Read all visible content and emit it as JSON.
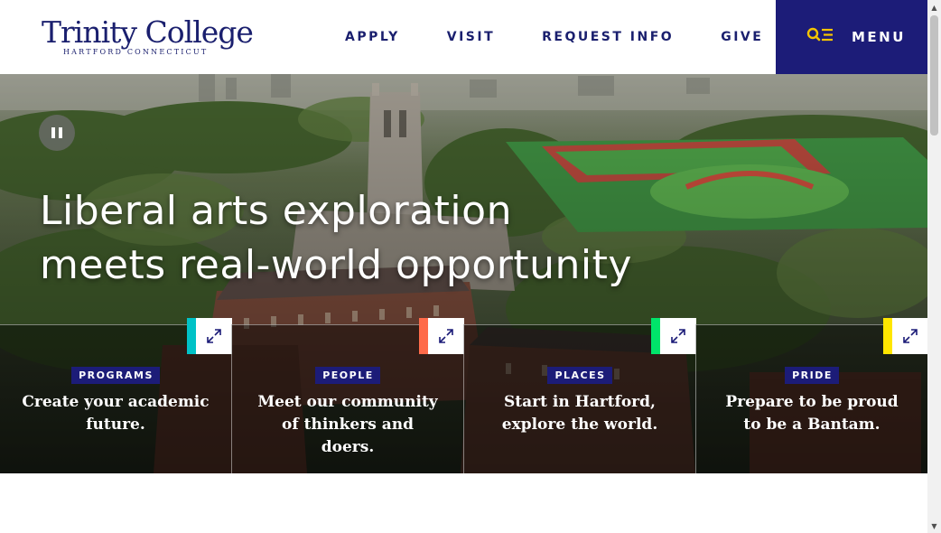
{
  "header": {
    "logo_main": "Trinity College",
    "logo_sub": "HARTFORD CONNECTICUT",
    "nav": [
      "APPLY",
      "VISIT",
      "REQUEST INFO",
      "GIVE"
    ],
    "menu_label": "MENU"
  },
  "hero": {
    "headline_line1": "Liberal arts exploration",
    "headline_line2": "meets real-world opportunity",
    "pause_icon": "pause-icon"
  },
  "cards": [
    {
      "tag": "PROGRAMS",
      "text": "Create your academic future.",
      "accent": "#00c2c7"
    },
    {
      "tag": "PEOPLE",
      "text": "Meet our community of thinkers and doers.",
      "accent": "#ff6b4a"
    },
    {
      "tag": "PLACES",
      "text": "Start in Hartford, explore the world.",
      "accent": "#00e46a"
    },
    {
      "tag": "PRIDE",
      "text": "Prepare to be proud to be a Bantam.",
      "accent": "#ffe600"
    }
  ],
  "colors": {
    "brand_navy": "#1c1c78",
    "white": "#ffffff"
  }
}
